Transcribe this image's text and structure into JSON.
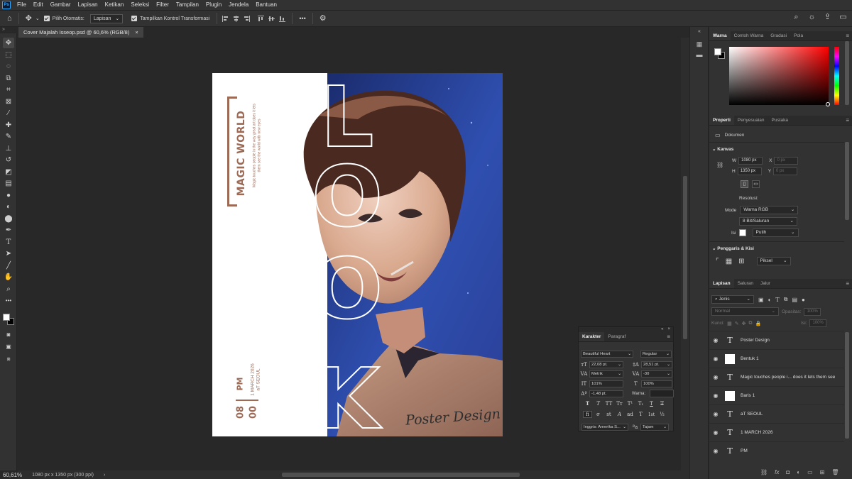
{
  "app": {
    "logo": "Ps"
  },
  "menu": [
    "File",
    "Edit",
    "Gambar",
    "Lapisan",
    "Ketikan",
    "Seleksi",
    "Filter",
    "Tampilan",
    "Plugin",
    "Jendela",
    "Bantuan"
  ],
  "options": {
    "auto_select_label": "Pilih Otomatis:",
    "auto_select_value": "Lapisan",
    "transform_label": "Tampilkan Kontrol Transformasi"
  },
  "document": {
    "tab_title": "Cover Majalah Isseop.psd @ 60,6% (RGB/8)",
    "zoom": "60,61%",
    "info": "1080 px x 1350 px (300 ppi)"
  },
  "poster": {
    "brand_title": "MAGIC WORLD",
    "tagline": "Magic touches people in the way great art does it lets them see the world with new eyes",
    "headline_letters": [
      "L",
      "O",
      "O",
      "K"
    ],
    "time_hour": "08",
    "time_minute": "00",
    "period": "PM",
    "date": "1 MARCH 2026",
    "place": "aT SEOUL",
    "signature": "Poster Design",
    "accent_color": "#9d6a56",
    "background_blue": "#2f4fb0"
  },
  "color_panel": {
    "tabs": [
      "Warna",
      "Contoh Warna",
      "Gradasi",
      "Pola"
    ]
  },
  "properties_panel": {
    "tabs": [
      "Properti",
      "Penyesuaian",
      "Pustaka"
    ],
    "doc_label": "Dokumen",
    "canvas_section": "Kanvas",
    "w_label": "W",
    "w_value": "1080 px",
    "h_label": "H",
    "h_value": "1350 px",
    "x_label": "X",
    "x_value": "0 px",
    "y_label": "Y",
    "y_value": "0 px",
    "resolution_label": "Resolusi:",
    "mode_label": "Mode",
    "mode_value": "Warna RGB",
    "depth_value": "8 Bit/Saluran",
    "fill_label": "Isi",
    "fill_value": "Putih",
    "rulers_section": "Penggaris & Kisi",
    "unit_value": "Piksel"
  },
  "layers_panel": {
    "tabs": [
      "Lapisan",
      "Saluran",
      "Jalur"
    ],
    "filter_value": "Jenis",
    "blend_value": "Normal",
    "opacity_label": "Opasitas:",
    "opacity_value": "100%",
    "lock_label": "Kunci:",
    "fill_label": "Isi:",
    "fill_value": "100%",
    "layers": [
      {
        "name": "Poster Design",
        "kind": "text"
      },
      {
        "name": "Bentuk 1",
        "kind": "shape"
      },
      {
        "name": "Magic touches people i... does it lets them see",
        "kind": "text"
      },
      {
        "name": "Baris 1",
        "kind": "shape"
      },
      {
        "name": "aT SEOUL",
        "kind": "text"
      },
      {
        "name": "1 MARCH 2026",
        "kind": "text"
      },
      {
        "name": "PM",
        "kind": "text"
      }
    ]
  },
  "character_panel": {
    "tabs": [
      "Karakter",
      "Paragraf"
    ],
    "font_family": "Beautiful Heart",
    "font_style": "Regular",
    "font_size": "22,08 pt.",
    "leading": "28,51 pt.",
    "kerning": "Metrik",
    "tracking": "-30",
    "vertical_scale": "101%",
    "horizontal_scale": "100%",
    "baseline_shift": "-1,48 pt.",
    "color_label": "Warna:",
    "language": "Inggris: Amerika S...",
    "antialias": "Tajam",
    "style_buttons": [
      "T",
      "T",
      "TT",
      "Tт",
      "T¹",
      "T₁",
      "T",
      "T"
    ],
    "opentype_buttons": [
      "fi",
      "σ",
      "st",
      "A",
      "ad",
      "T",
      "1st",
      "½"
    ]
  }
}
